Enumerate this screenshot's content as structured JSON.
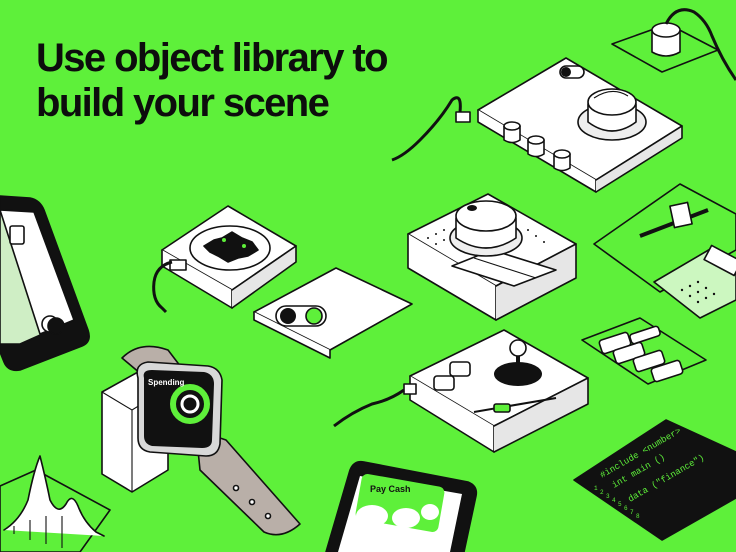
{
  "headline": {
    "line1": "Use object library to",
    "line2": "build your scene"
  },
  "watch": {
    "screen_label": "Spending"
  },
  "phone": {
    "card_label": "Pay Cash"
  },
  "code_terminal": {
    "lines": [
      "#include <number>",
      "int main ()",
      "data (\"finance\")"
    ],
    "line_numbers": [
      "1",
      "2",
      "3",
      "4",
      "5",
      "6",
      "7",
      "8"
    ]
  },
  "colors": {
    "background": "#5ef03a",
    "ink": "#111111",
    "paper": "#ffffff",
    "accent_green": "#5ef03a",
    "watch_band": "#b9afa8",
    "card_mint": "#cfeec5"
  },
  "icons": [
    "dpad-icon",
    "toggle-icon",
    "knob-icon",
    "joystick-icon",
    "slider-icon",
    "watch-icon",
    "phone-icon",
    "card-icon",
    "terminal-icon",
    "graph-icon",
    "cable-icon"
  ]
}
